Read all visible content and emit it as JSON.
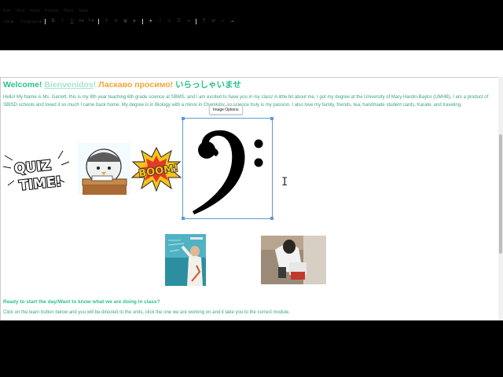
{
  "menubar": {
    "items": [
      "Edit",
      "View",
      "Insert",
      "Format",
      "Tools",
      "Table"
    ]
  },
  "toolbar": {
    "font_size": "24pt",
    "block_format": "Paragraph",
    "buttons": [
      "bold-icon",
      "italic-icon",
      "underline-icon",
      "text-color-icon",
      "highlight-icon",
      "link-icon",
      "unlink-icon",
      "image-icon",
      "media-icon",
      "embed-icon",
      "equation-icon",
      "align-icon",
      "list-icon",
      "indent-icon",
      "ltr-icon",
      "table-icon",
      "code-icon",
      "clear-icon"
    ]
  },
  "content": {
    "heading": {
      "en": "Welcome!",
      "es": "Bienvenidos",
      "ex": "!",
      "ru": "Ласкаво просимо!",
      "jp": "いらっしゃいませ"
    },
    "intro": "Hello! My Name is Ms. Garrett, this is my 8th year teaching 6th grade science at SBMS, and I am excited to have you in my class! A little bit about me, I got my degree at the University of Mary Hardin-Baylor (UMHB), I am a product of SBISD schools and loved it so much I came back home. My degree is in Biology with a minor in Chemistry, so science truly is my passion. I also love my family, friends, tea, handmade student cards, Karate, and traveling.",
    "image_tooltip": "Image Options",
    "quiz_text": [
      "QUIZ",
      "TIME!"
    ],
    "boom_text": "BOOM!",
    "ready": "Ready to start the day/Want to know what we are doing in class?",
    "instructions": "Click on the learn button below and you will be directed to the units, click the one we are working on and it take you to the correct module."
  },
  "colors": {
    "accent": "#2bbf8f",
    "body_text": "#3aa57d",
    "selection": "#5b9bd5",
    "russian": "#f2a72f"
  }
}
